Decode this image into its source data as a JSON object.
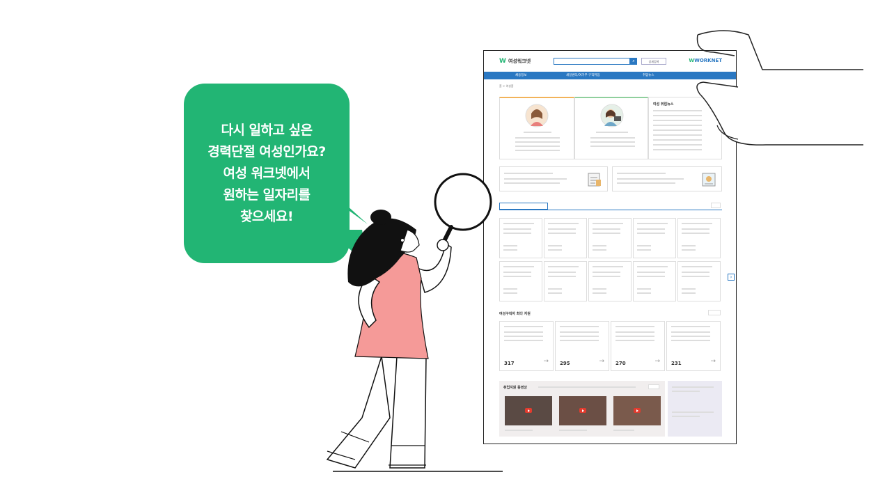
{
  "bubble": {
    "lines": [
      "다시 일하고 싶은",
      "경력단절 여성인가요?",
      "여성 워크넷에서",
      "원하는 일자리를",
      "찾으세요!"
    ]
  },
  "site": {
    "logo_left": "여성워크넷",
    "logo_right": "WORKNET",
    "detail_search": "상세검색",
    "nav": [
      "채용정보",
      "새일센터/여가부·구직취업",
      "취업뉴스"
    ],
    "breadcrumb": "홈 > 여성홈",
    "news_title": "여성 취업뉴스",
    "section_title_jobs": "여성구직자 최다 지원",
    "section_title_video": "취업지원 동영상",
    "counts": [
      "317",
      "295",
      "270",
      "231"
    ]
  },
  "colors": {
    "bubble": "#22b574",
    "nav": "#2a78c2",
    "accent_pink": "#f59a98"
  }
}
